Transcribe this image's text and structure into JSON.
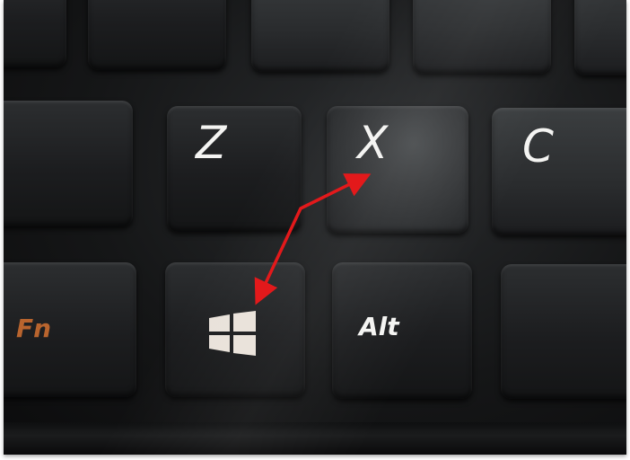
{
  "keyboard": {
    "row_top": {
      "keys": [
        "",
        "",
        "",
        "",
        ""
      ]
    },
    "row_middle": {
      "keys": [
        {
          "id": "blank",
          "label": ""
        },
        {
          "id": "z",
          "label": "Z"
        },
        {
          "id": "x",
          "label": "X"
        },
        {
          "id": "c",
          "label": "C"
        }
      ]
    },
    "row_bottom": {
      "keys": [
        {
          "id": "fn",
          "label": "Fn"
        },
        {
          "id": "windows",
          "label": "",
          "icon": "windows-logo-icon"
        },
        {
          "id": "alt",
          "label": "Alt"
        },
        {
          "id": "blank",
          "label": ""
        }
      ]
    }
  },
  "annotation": {
    "type": "double-headed-arrow",
    "color": "#e3191b",
    "connects": [
      "x",
      "windows"
    ]
  },
  "colors": {
    "key_legend": "#f4f4f2",
    "fn_legend": "#b8642e",
    "windows_logo": "#e9e2da"
  }
}
